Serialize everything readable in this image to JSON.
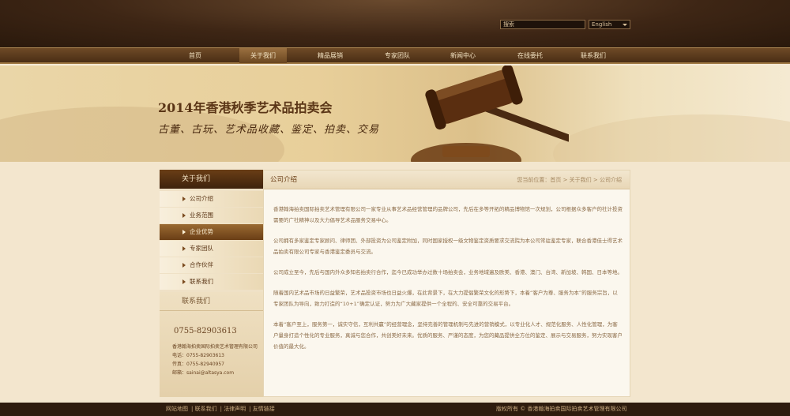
{
  "header": {
    "search_placeholder": "搜索",
    "language": "English",
    "nav": [
      "首页",
      "关于我们",
      "精品展销",
      "专家团队",
      "新闻中心",
      "在线委托",
      "联系我们"
    ],
    "active_nav": "关于我们"
  },
  "banner": {
    "title": "2014年香港秋季艺术品拍卖会",
    "subtitle": "古董、古玩、艺术品收藏、鉴定、拍卖、交易"
  },
  "sidebar": {
    "title": "关于我们",
    "items": [
      "公司介绍",
      "业务范围",
      "企业优势",
      "专家团队",
      "合作伙伴",
      "联系我们"
    ],
    "active_item": "企业优势",
    "contact_title": "联系我们",
    "phone_big": "0755-82903613",
    "company": "香港翰海拍卖国际拍卖艺术管理有限公司",
    "tel": "电话：0755-82903613",
    "fax": "传真：0755-82940957",
    "email": "邮箱：sainai@altasya.com"
  },
  "content": {
    "title": "公司介绍",
    "breadcrumb": "您当前位置：首页 > 关于我们 > 公司介绍",
    "paragraphs": [
      "香港翰海拍卖国际拍卖艺术管理有限公司一家专业从事艺术品经营管理的品牌公司，先后在多等开拓的精品博物馆一次规划，公司根据众多客户的社计投资需要的广社精神以及大力倡导艺术品服务交易中心。",
      "公司拥有多家鉴定专家顾问、律师团、外部投资为公司鉴定附加，同时国家授权一级文物鉴定资质要求交流院为本公司常驻鉴定专家，联合香港佳士得艺术品拍卖有限公司专家与香港鉴定委员与交流。",
      "公司成立至今，先后与国内外众多知名拍卖行合作，迄今已成功举办过数十场拍卖会，业务地域遍及欧美、香港、澳门、台湾、新加坡、韩国、日本等地。",
      "随着国内艺术品市场的日益繁荣，艺术品投资市场也日益火爆，在此背景下，在大力提倡繁荣文化的形势下，本着“客户为尊、服务为本”的服务宗旨，以专家团队为导向，致力打造的“10+1”确定认证，努力为广大藏家提供一个全程的、安全可靠的交易平台。",
      "本着“客户至上，服务第一，诚实守信，互利共赢”的经营理念，坚持完善的管理机制与先进的营销模式，以专业化人才、规范化服务、人性化管理，为客户量身打造个性化的专业服务，真诚与您合作，共创美好未来。优质的服务、严谨的态度，为您的藏品提供全方位的鉴定、展示与交易服务，努力实现客户价值的最大化。"
    ]
  },
  "footer": {
    "links": [
      "网站地图",
      "联系我们",
      "法律声明",
      "友情链接"
    ],
    "copyright": "版权所有 © 香港翰海拍卖国际拍卖艺术管理有限公司"
  }
}
